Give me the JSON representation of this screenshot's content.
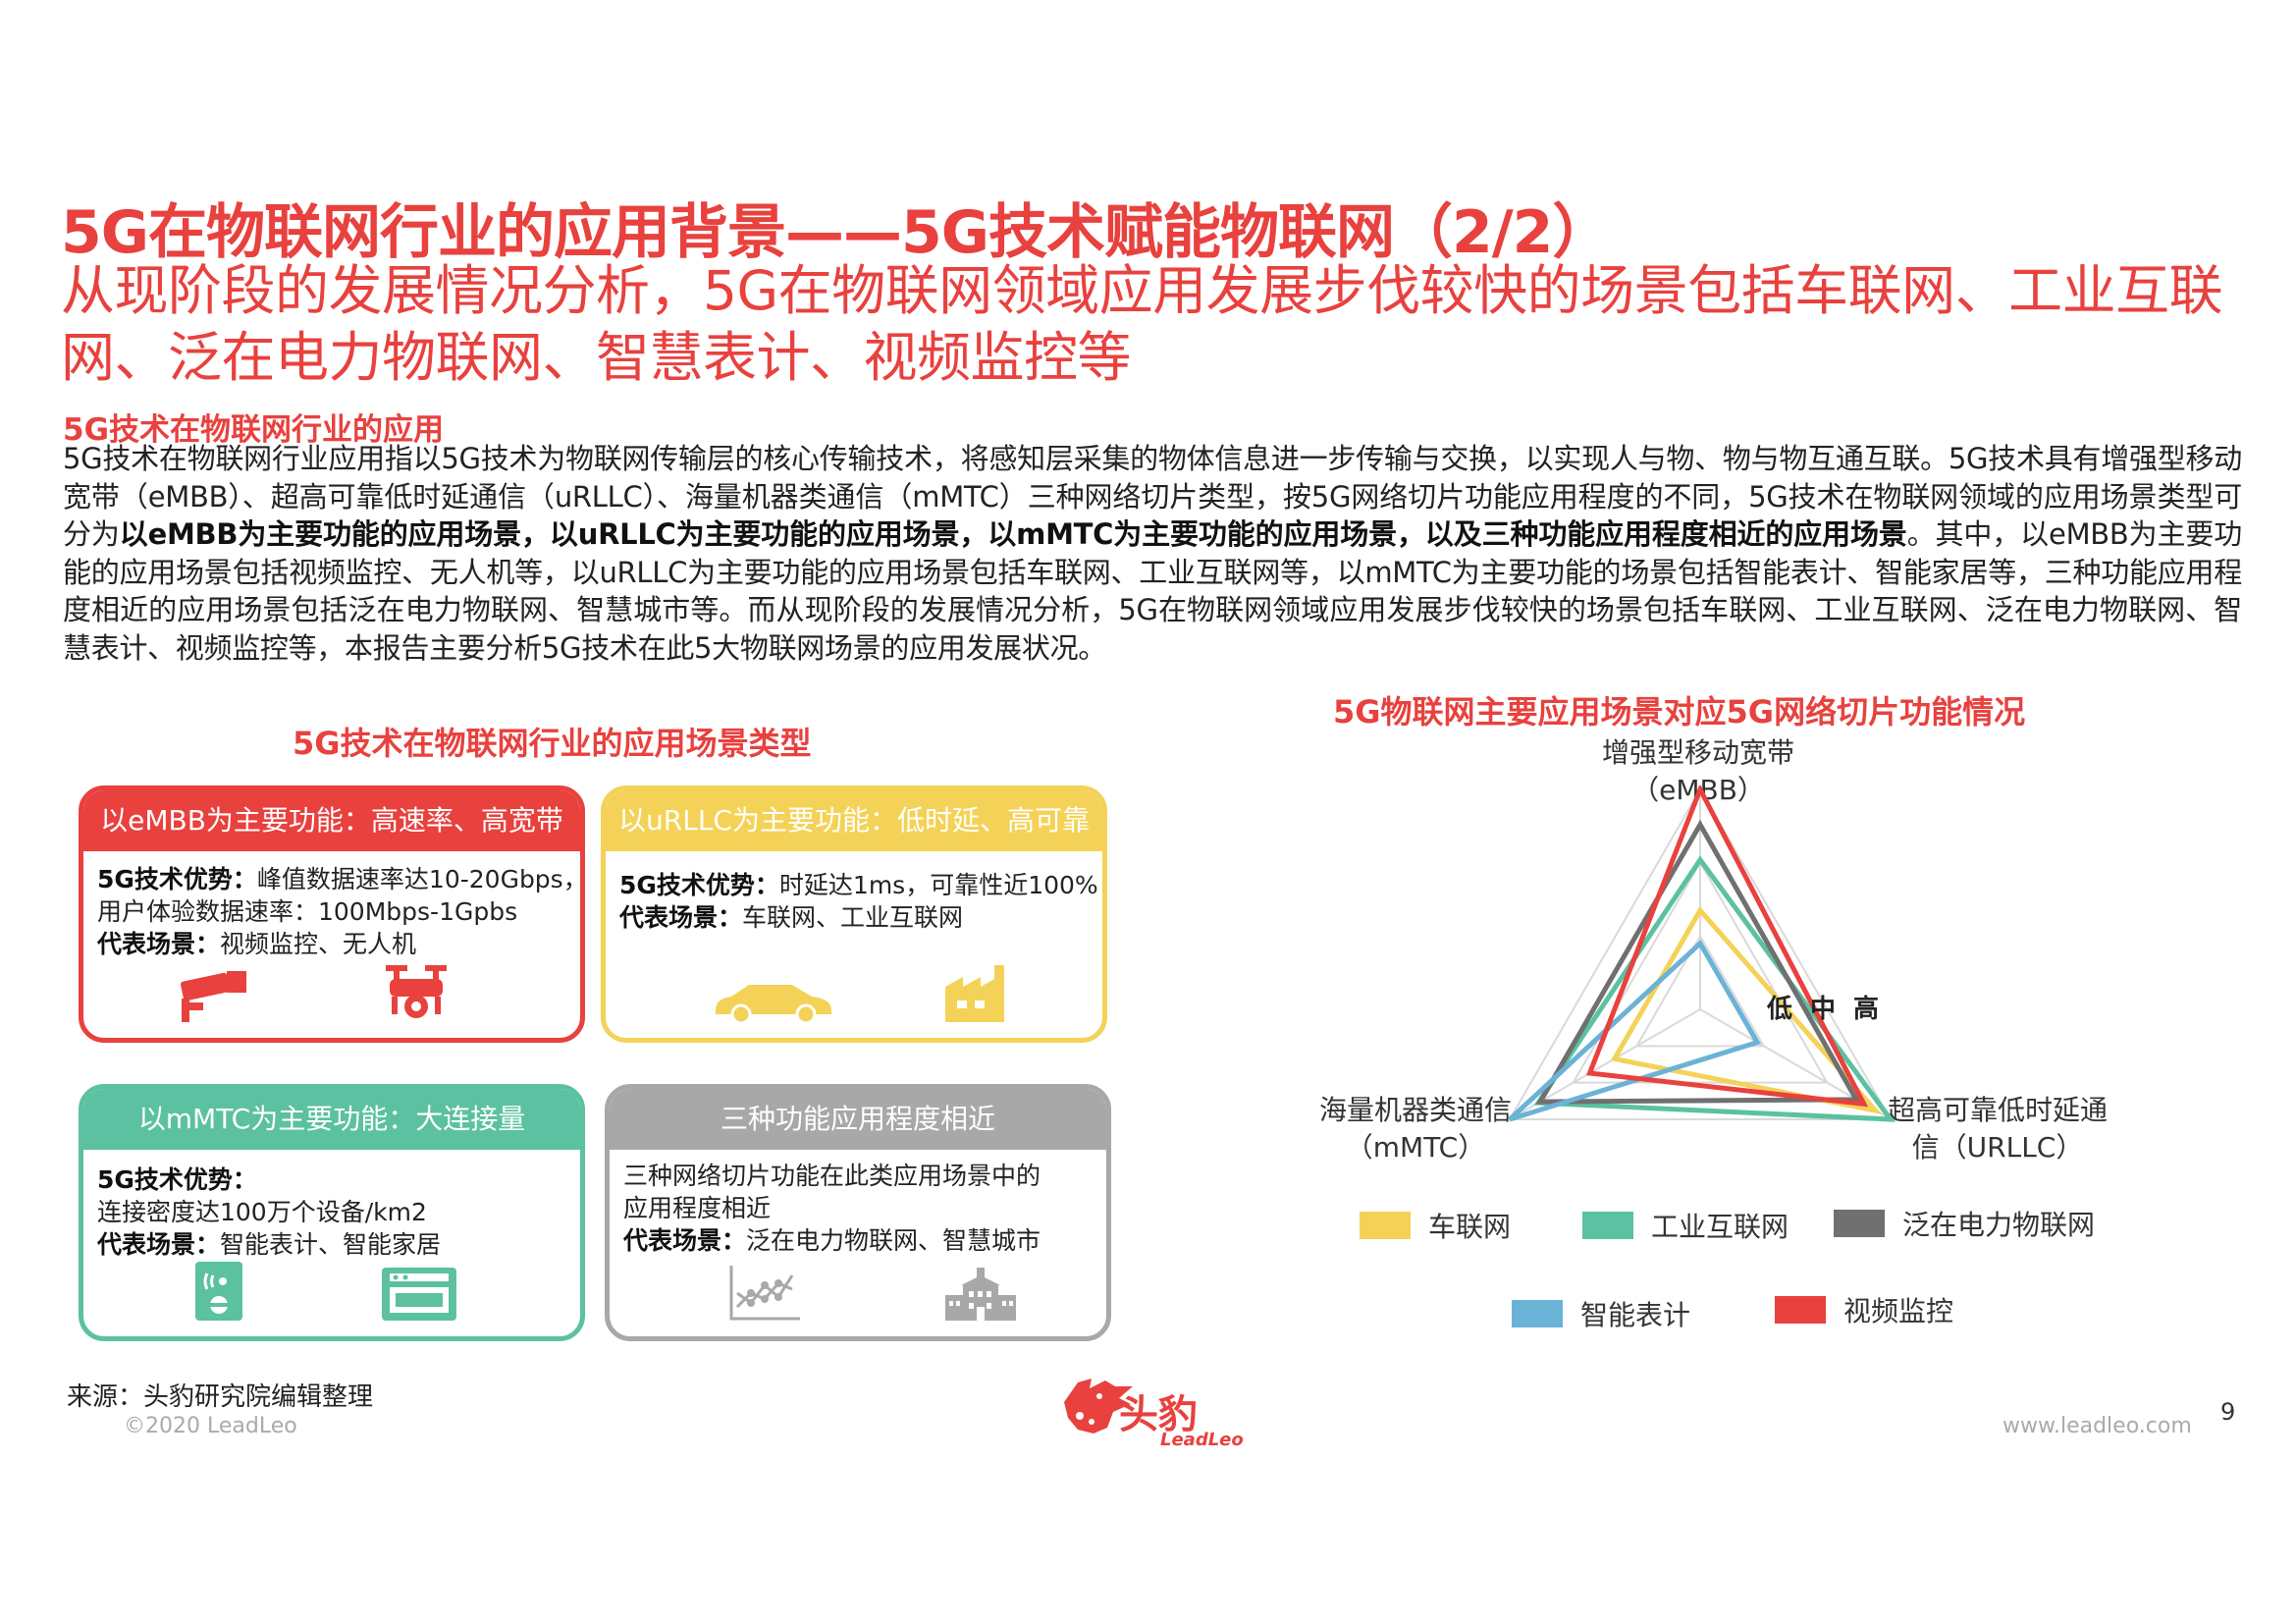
{
  "header": {
    "title": "5G在物联网行业的应用背景——5G技术赋能物联网（2/2）",
    "subtitle": "从现阶段的发展情况分析，5G在物联网领域应用发展步伐较快的场景包括车联网、工业互联网、泛在电力物联网、智慧表计、视频监控等"
  },
  "section": {
    "heading": "5G技术在物联网行业的应用",
    "p1": "5G技术在物联网行业应用指以5G技术为物联网传输层的核心传输技术，将感知层采集的物体信息进一步传输与交换，以实现人与物、物与物互通互联。5G技术具有增强型移动宽带（eMBB）、超高可靠低时延通信（uRLLC）、海量机器类通信（mMTC）三种网络切片类型，按5G网络切片功能应用程度的不同，5G技术在物联网领域的应用场景类型可分为",
    "p_bold": "以eMBB为主要功能的应用场景，以uRLLC为主要功能的应用场景，以mMTC为主要功能的应用场景，以及三种功能应用程度相近的应用场景",
    "p2": "。其中，以eMBB为主要功能的应用场景包括视频监控、无人机等，以uRLLC为主要功能的应用场景包括车联网、工业互联网等，以mMTC为主要功能的场景包括智能表计、智能家居等，三种功能应用程度相近的应用场景包括泛在电力物联网、智慧城市等。而从现阶段的发展情况分析，5G在物联网领域应用发展步伐较快的场景包括车联网、工业互联网、泛在电力物联网、智慧表计、视频监控等，本报告主要分析5G技术在此5大物联网场景的应用发展状况。"
  },
  "left_panel": {
    "title": "5G技术在物联网行业的应用场景类型",
    "cards": [
      {
        "color": "#e8413e",
        "head": "以eMBB为主要功能：高速率、高宽带",
        "adv_label": "5G技术优势：",
        "adv_text": "峰值数据速率达10-20Gbps，",
        "adv_text2": "用户体验数据速率：100Mbps-1Gpbs",
        "scene_label": "代表场景：",
        "scene_text": "视频监控、无人机",
        "icons": [
          "cctv-camera-icon",
          "drone-icon"
        ]
      },
      {
        "color": "#f4d258",
        "head": "以uRLLC为主要功能：低时延、高可靠",
        "adv_label": "5G技术优势：",
        "adv_text": "时延达1ms，可靠性近100%",
        "adv_text2": "",
        "scene_label": "代表场景：",
        "scene_text": "车联网、工业互联网",
        "icons": [
          "car-icon",
          "factory-icon"
        ]
      },
      {
        "color": "#5bc1a1",
        "head": "以mMTC为主要功能：大连接量",
        "adv_label": "5G技术优势：",
        "adv_text": "",
        "adv_text2": "连接密度达100万个设备/km2",
        "scene_label": "代表场景：",
        "scene_text": "智能表计、智能家居",
        "icons": [
          "smart-meter-icon",
          "oven-icon"
        ]
      },
      {
        "color": "#a8a8a8",
        "head": "三种功能应用程度相近",
        "adv_label": "",
        "adv_text": "三种网络切片功能在此类应用场景中的",
        "adv_text2": "应用程度相近",
        "scene_label": "代表场景：",
        "scene_text": "泛在电力物联网、智慧城市",
        "icons": [
          "line-chart-icon",
          "city-building-icon"
        ]
      }
    ]
  },
  "chart_data": {
    "type": "radar",
    "title": "5G物联网主要应用场景对应5G网络切片功能情况",
    "axes": [
      "增强型移动宽带（eMBB）",
      "超高可靠低时延通信（URLLC）",
      "海量机器类通信（mMTC）"
    ],
    "axis_labels": {
      "top_line1": "增强型移动宽带",
      "top_line2": "（eMBB）",
      "right_line1": "超高可靠低时延通",
      "right_line2": "信（URLLC）",
      "left_line1": "海量机器类通信",
      "left_line2": "（mMTC）"
    },
    "scale_labels": [
      "低",
      "中",
      "高"
    ],
    "range": [
      0,
      1
    ],
    "series": [
      {
        "name": "车联网",
        "color": "#f4d258",
        "values": [
          0.45,
          0.92,
          0.45
        ]
      },
      {
        "name": "工业互联网",
        "color": "#5bc1a1",
        "values": [
          0.68,
          1.0,
          0.85
        ]
      },
      {
        "name": "泛在电力物联网",
        "color": "#707070",
        "values": [
          0.84,
          0.82,
          0.84
        ]
      },
      {
        "name": "智能表计",
        "color": "#6bb3d6",
        "values": [
          0.3,
          0.3,
          1.0
        ]
      },
      {
        "name": "视频监控",
        "color": "#e8413e",
        "values": [
          1.0,
          0.86,
          0.58
        ]
      }
    ]
  },
  "footer": {
    "source": "来源：头豹研究院编辑整理",
    "copyright": "©2020 LeadLeo",
    "site": "www.leadleo.com",
    "page": "9",
    "logo_cn": "头豹",
    "logo_en": "LeadLeo"
  }
}
